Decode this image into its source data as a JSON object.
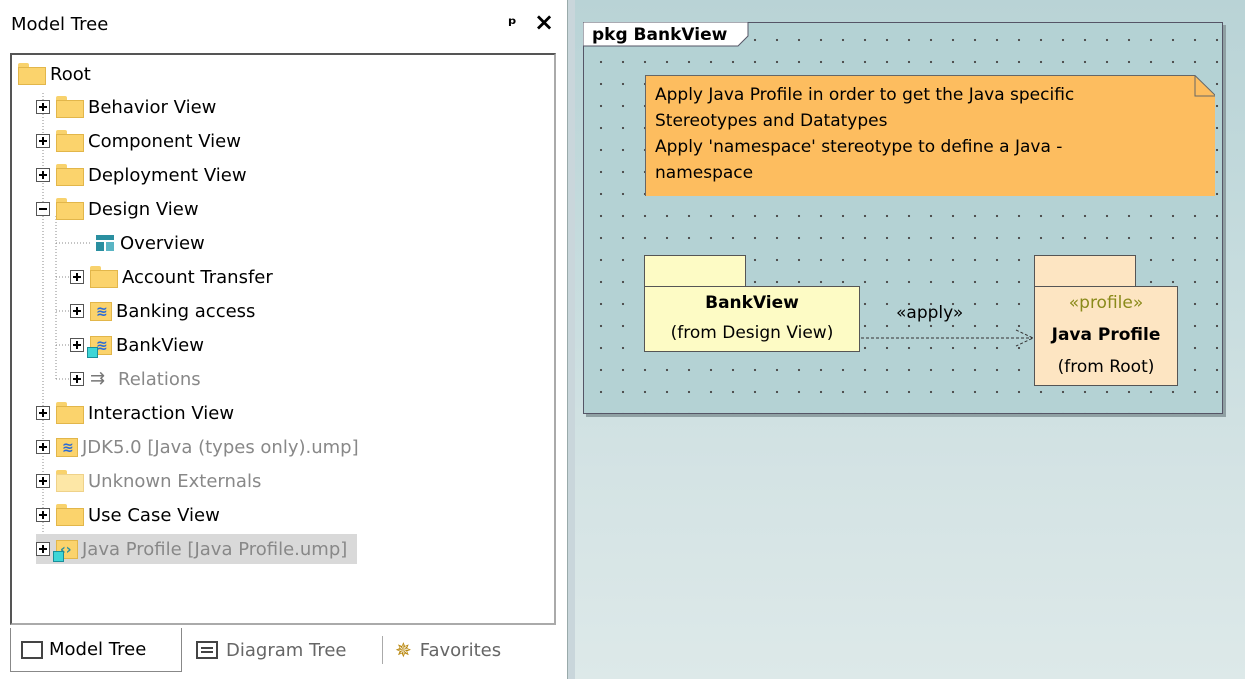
{
  "model_tree": {
    "title": "Model Tree",
    "pin_icon": "pin-icon",
    "close_icon": "close-icon",
    "items": [
      {
        "label": "Root",
        "icon": "folder-icon"
      },
      {
        "label": "Behavior View",
        "icon": "folder-icon"
      },
      {
        "label": "Component View",
        "icon": "folder-icon"
      },
      {
        "label": "Deployment View",
        "icon": "folder-icon"
      },
      {
        "label": "Design View",
        "icon": "folder-icon"
      },
      {
        "label": "Overview",
        "icon": "diagram-icon"
      },
      {
        "label": "Account Transfer",
        "icon": "folder-icon"
      },
      {
        "label": "Banking access",
        "icon": "java-package-icon"
      },
      {
        "label": "BankView",
        "icon": "java-package-icon"
      },
      {
        "label": "Relations",
        "icon": "relations-icon"
      },
      {
        "label": "Interaction View",
        "icon": "folder-icon"
      },
      {
        "label": "JDK5.0 [Java (types only).ump]",
        "icon": "java-package-icon"
      },
      {
        "label": "Unknown Externals",
        "icon": "folder-icon"
      },
      {
        "label": "Use Case View",
        "icon": "folder-icon"
      },
      {
        "label": "Java Profile [Java Profile.ump]",
        "icon": "profile-package-icon"
      }
    ],
    "tabs": [
      {
        "label": "Model Tree",
        "icon": "folder-icon"
      },
      {
        "label": "Diagram Tree",
        "icon": "diagram-tree-icon"
      },
      {
        "label": "Favorites",
        "icon": "favorites-icon"
      }
    ]
  },
  "diagram": {
    "frame_label": "pkg BankView",
    "note_lines": [
      "Apply Java Profile in order to get the Java specific",
      "Stereotypes and Datatypes",
      "Apply 'namespace' stereotype to define a Java -",
      "namespace"
    ],
    "bankview": {
      "name": "BankView",
      "from": "(from Design View)"
    },
    "java_profile": {
      "stereotype": "«profile»",
      "name": "Java Profile",
      "from": "(from Root)"
    },
    "dependency_label": "«apply»",
    "colors": {
      "background": "#b4d2d4",
      "note": "#fdbd5f",
      "package": "#fdfbc5",
      "profile": "#fde5c2",
      "selection": "#d9d9d9"
    }
  }
}
